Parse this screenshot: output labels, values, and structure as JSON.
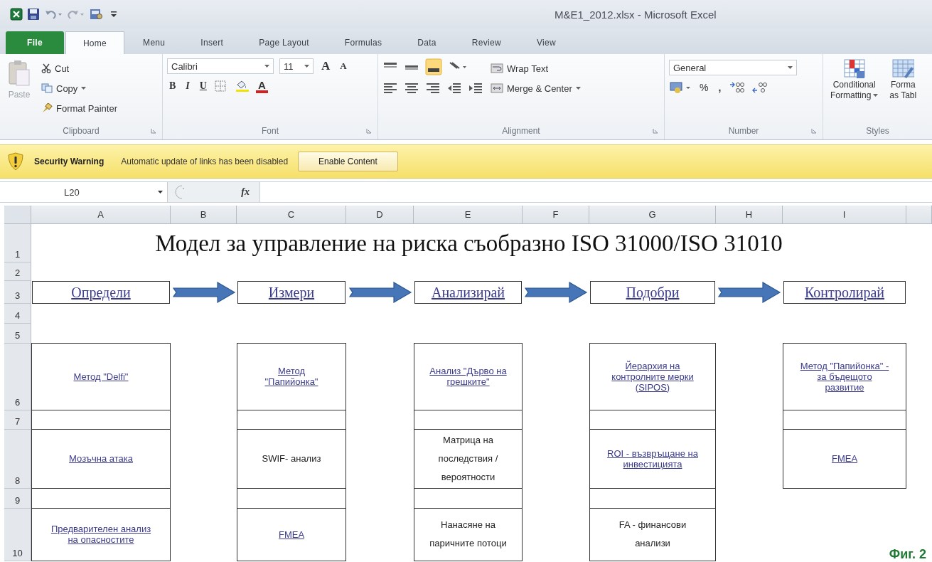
{
  "window": {
    "title": "M&E1_2012.xlsx  -  Microsoft Excel"
  },
  "tabs": [
    {
      "label": "File",
      "kind": "file",
      "selected": false
    },
    {
      "label": "Home",
      "kind": "tab",
      "selected": true
    },
    {
      "label": "Menu",
      "kind": "tab",
      "selected": false
    },
    {
      "label": "Insert",
      "kind": "tab",
      "selected": false
    },
    {
      "label": "Page Layout",
      "kind": "tab",
      "selected": false
    },
    {
      "label": "Formulas",
      "kind": "tab",
      "selected": false
    },
    {
      "label": "Data",
      "kind": "tab",
      "selected": false
    },
    {
      "label": "Review",
      "kind": "tab",
      "selected": false
    },
    {
      "label": "View",
      "kind": "tab",
      "selected": false
    }
  ],
  "ribbon": {
    "clipboard": {
      "label": "Clipboard",
      "paste": "Paste",
      "cut": "Cut",
      "copy": "Copy",
      "format_painter": "Format Painter"
    },
    "font": {
      "label": "Font",
      "font_name": "Calibri",
      "font_size": "11",
      "grow": "A",
      "shrink": "A",
      "bold": "B",
      "italic": "I",
      "underline": "U",
      "font_color": "A"
    },
    "alignment": {
      "label": "Alignment",
      "wrap_text": "Wrap Text",
      "merge_center": "Merge & Center"
    },
    "number": {
      "label": "Number",
      "format": "General",
      "percent": "%",
      "comma": ","
    },
    "styles": {
      "label": "Styles",
      "conditional": [
        "Conditional",
        "Formatting"
      ],
      "format_table": [
        "Forma",
        "as Tabl"
      ]
    }
  },
  "security_bar": {
    "title": "Security Warning",
    "message": "Automatic update of links has been disabled",
    "button": "Enable Content"
  },
  "formula_bar": {
    "name_box": "L20",
    "fx": "fx"
  },
  "sheet": {
    "columns": [
      "A",
      "B",
      "C",
      "D",
      "E",
      "F",
      "G",
      "H",
      "I"
    ],
    "row_numbers": [
      "1",
      "2",
      "3",
      "4",
      "5",
      "6",
      "7",
      "8",
      "9",
      "10"
    ],
    "title": "Модел за управление на риска съобразно ISO 31000/ISO 31010",
    "steps": [
      {
        "label": "Определи"
      },
      {
        "label": "Измери"
      },
      {
        "label": "Анализирай"
      },
      {
        "label": "Подобри"
      },
      {
        "label": "Контролирай"
      }
    ],
    "method_columns": [
      {
        "cells": [
          {
            "text": "Метод \"Delfi\"",
            "link": true
          },
          {
            "text": "Мозъчна атака",
            "link": true
          },
          {
            "text": "Предварителен анализ на опасностите",
            "link": true
          }
        ]
      },
      {
        "cells": [
          {
            "text": "Метод \"Папийонка\"",
            "link": true
          },
          {
            "text": "SWIF- анализ",
            "link": false
          },
          {
            "text": "FMEA",
            "link": true
          }
        ]
      },
      {
        "cells": [
          {
            "text": "Анализ \"Дърво на грешките\"",
            "link": true
          },
          {
            "text": "Матрица на последствия / вероятности",
            "link": false
          },
          {
            "text": "Нанасяне на паричните потоци",
            "link": false
          }
        ]
      },
      {
        "cells": [
          {
            "text": "Йерархия на контролните мерки (SIPOS)",
            "link": true
          },
          {
            "text": "ROI - възвръщане на инвестицията",
            "link": true
          },
          {
            "text": "FA - финансови анализи",
            "link": false
          }
        ]
      },
      {
        "cells": [
          {
            "text": "Метод \"Папийонка\" - за бъдещото развитие",
            "link": true
          },
          {
            "text": "FMEA",
            "link": true
          }
        ]
      }
    ]
  },
  "caption": "Фиг. 2"
}
